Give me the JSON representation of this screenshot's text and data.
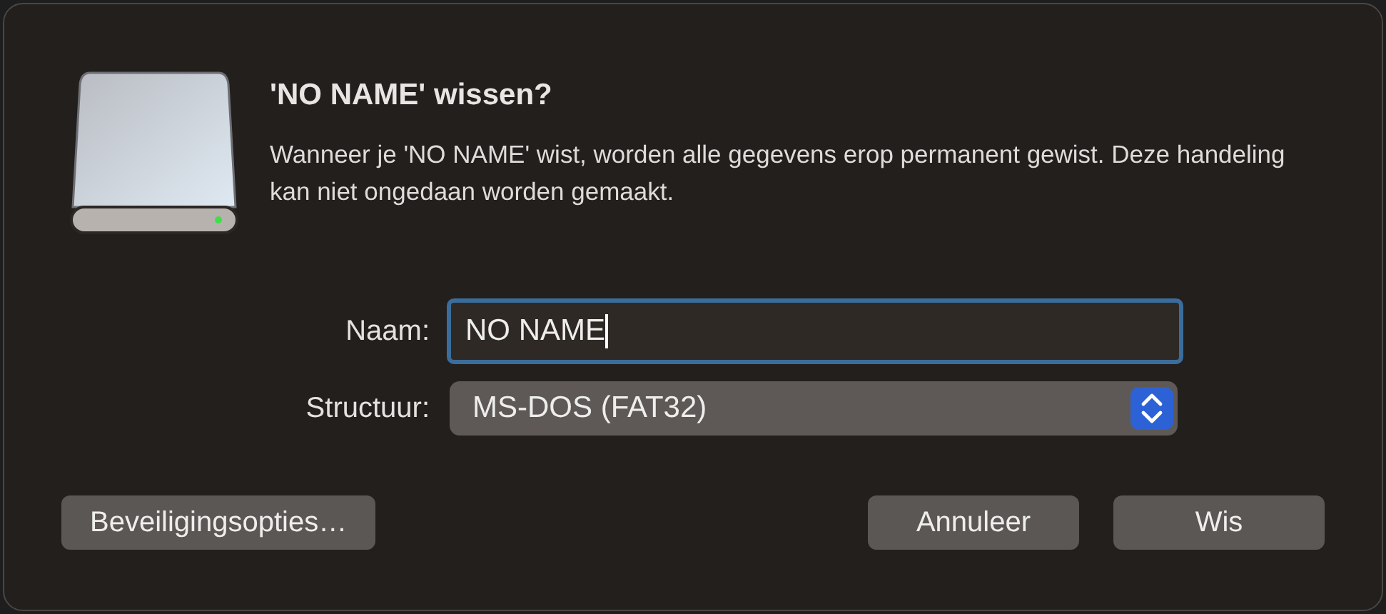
{
  "dialog": {
    "title": "'NO NAME' wissen?",
    "message": "Wanneer je 'NO NAME' wist, worden alle gegevens erop permanent gewist. Deze handeling kan niet ongedaan worden gemaakt.",
    "fields": [
      {
        "kind": "text",
        "label": "Naam:",
        "value": "NO NAME",
        "focused": true
      },
      {
        "kind": "select",
        "label": "Structuur:",
        "value": "MS-DOS (FAT32)"
      }
    ],
    "buttons": [
      {
        "label": "Beveiligingsopties…",
        "kind": "left"
      },
      {
        "label": "Annuleer",
        "kind": "right"
      },
      {
        "label": "Wis",
        "kind": "right"
      }
    ]
  }
}
